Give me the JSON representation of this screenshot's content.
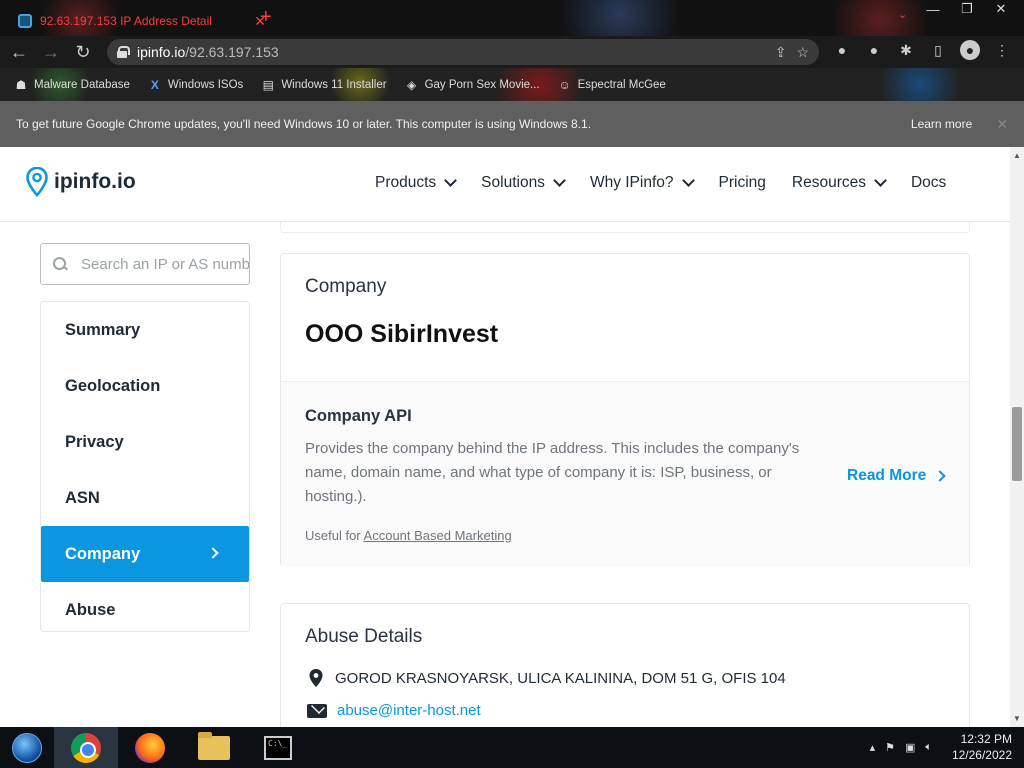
{
  "browser": {
    "tab_title": "92.63.197.153 IP Address Detail",
    "tab_close": "✕",
    "new_tab": "+",
    "window_controls": [
      "—",
      "❐",
      "✕"
    ],
    "url_host": "ipinfo.io",
    "url_path": "/92.63.197.153",
    "bookmarks": [
      "Malware Database",
      "Windows ISOs",
      "Windows 11 Installer",
      "Gay Porn Sex Movie...",
      "Espectral McGee"
    ],
    "update_message": "To get future Google Chrome updates, you'll need Windows 10 or later. This computer is using Windows 8.1.",
    "learn_more": "Learn more"
  },
  "site": {
    "logo_text": "ipinfo.io",
    "nav": [
      {
        "label": "Products",
        "dropdown": true
      },
      {
        "label": "Solutions",
        "dropdown": true
      },
      {
        "label": "Why IPinfo?",
        "dropdown": true
      },
      {
        "label": "Pricing",
        "dropdown": false
      },
      {
        "label": "Resources",
        "dropdown": true
      },
      {
        "label": "Docs",
        "dropdown": false
      }
    ],
    "search_placeholder": "Search an IP or AS number",
    "sidebar": [
      "Summary",
      "Geolocation",
      "Privacy",
      "ASN",
      "Company",
      "Abuse"
    ],
    "sidebar_active": "Company"
  },
  "company": {
    "label": "Company",
    "name": "OOO SibirInvest",
    "api_heading": "Company API",
    "api_description": "Provides the company behind the IP address. This includes the company's name, domain name, and what type of company it is: ISP, business, or hosting.).",
    "read_more": "Read More",
    "useful_prefix": "Useful for",
    "useful_link": "Account Based Marketing"
  },
  "abuse": {
    "label": "Abuse Details",
    "address": "GOROD KRASNOYARSK, ULICA KALININA, DOM 51 G, OFIS 104",
    "email": "abuse@inter-host.net"
  },
  "taskbar": {
    "time": "12:32 PM",
    "date": "12/26/2022"
  },
  "colors": {
    "accent": "#0a97e0",
    "infobar": "#5f5f5f"
  }
}
